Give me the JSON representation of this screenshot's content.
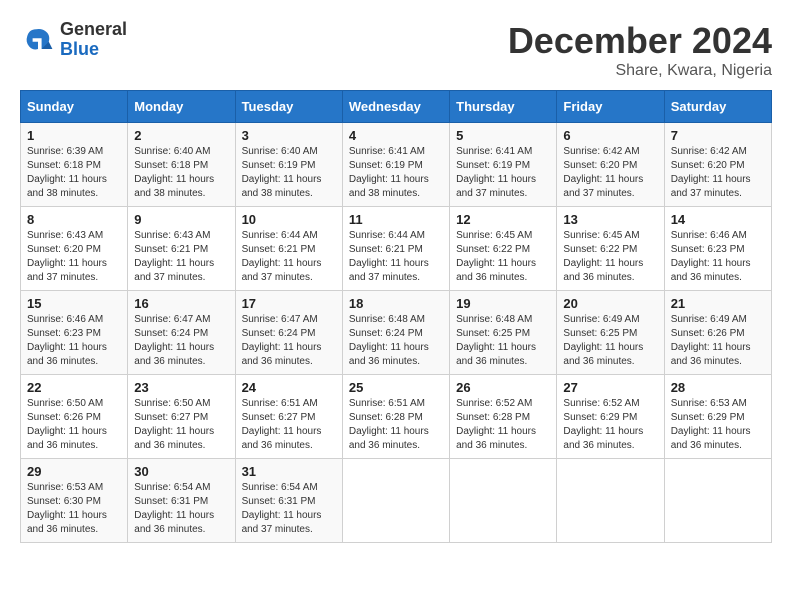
{
  "header": {
    "logo_general": "General",
    "logo_blue": "Blue",
    "title": "December 2024",
    "subtitle": "Share, Kwara, Nigeria"
  },
  "calendar": {
    "days_of_week": [
      "Sunday",
      "Monday",
      "Tuesday",
      "Wednesday",
      "Thursday",
      "Friday",
      "Saturday"
    ],
    "weeks": [
      [
        {
          "day": "1",
          "info": "Sunrise: 6:39 AM\nSunset: 6:18 PM\nDaylight: 11 hours\nand 38 minutes."
        },
        {
          "day": "2",
          "info": "Sunrise: 6:40 AM\nSunset: 6:18 PM\nDaylight: 11 hours\nand 38 minutes."
        },
        {
          "day": "3",
          "info": "Sunrise: 6:40 AM\nSunset: 6:19 PM\nDaylight: 11 hours\nand 38 minutes."
        },
        {
          "day": "4",
          "info": "Sunrise: 6:41 AM\nSunset: 6:19 PM\nDaylight: 11 hours\nand 38 minutes."
        },
        {
          "day": "5",
          "info": "Sunrise: 6:41 AM\nSunset: 6:19 PM\nDaylight: 11 hours\nand 37 minutes."
        },
        {
          "day": "6",
          "info": "Sunrise: 6:42 AM\nSunset: 6:20 PM\nDaylight: 11 hours\nand 37 minutes."
        },
        {
          "day": "7",
          "info": "Sunrise: 6:42 AM\nSunset: 6:20 PM\nDaylight: 11 hours\nand 37 minutes."
        }
      ],
      [
        {
          "day": "8",
          "info": "Sunrise: 6:43 AM\nSunset: 6:20 PM\nDaylight: 11 hours\nand 37 minutes."
        },
        {
          "day": "9",
          "info": "Sunrise: 6:43 AM\nSunset: 6:21 PM\nDaylight: 11 hours\nand 37 minutes."
        },
        {
          "day": "10",
          "info": "Sunrise: 6:44 AM\nSunset: 6:21 PM\nDaylight: 11 hours\nand 37 minutes."
        },
        {
          "day": "11",
          "info": "Sunrise: 6:44 AM\nSunset: 6:21 PM\nDaylight: 11 hours\nand 37 minutes."
        },
        {
          "day": "12",
          "info": "Sunrise: 6:45 AM\nSunset: 6:22 PM\nDaylight: 11 hours\nand 36 minutes."
        },
        {
          "day": "13",
          "info": "Sunrise: 6:45 AM\nSunset: 6:22 PM\nDaylight: 11 hours\nand 36 minutes."
        },
        {
          "day": "14",
          "info": "Sunrise: 6:46 AM\nSunset: 6:23 PM\nDaylight: 11 hours\nand 36 minutes."
        }
      ],
      [
        {
          "day": "15",
          "info": "Sunrise: 6:46 AM\nSunset: 6:23 PM\nDaylight: 11 hours\nand 36 minutes."
        },
        {
          "day": "16",
          "info": "Sunrise: 6:47 AM\nSunset: 6:24 PM\nDaylight: 11 hours\nand 36 minutes."
        },
        {
          "day": "17",
          "info": "Sunrise: 6:47 AM\nSunset: 6:24 PM\nDaylight: 11 hours\nand 36 minutes."
        },
        {
          "day": "18",
          "info": "Sunrise: 6:48 AM\nSunset: 6:24 PM\nDaylight: 11 hours\nand 36 minutes."
        },
        {
          "day": "19",
          "info": "Sunrise: 6:48 AM\nSunset: 6:25 PM\nDaylight: 11 hours\nand 36 minutes."
        },
        {
          "day": "20",
          "info": "Sunrise: 6:49 AM\nSunset: 6:25 PM\nDaylight: 11 hours\nand 36 minutes."
        },
        {
          "day": "21",
          "info": "Sunrise: 6:49 AM\nSunset: 6:26 PM\nDaylight: 11 hours\nand 36 minutes."
        }
      ],
      [
        {
          "day": "22",
          "info": "Sunrise: 6:50 AM\nSunset: 6:26 PM\nDaylight: 11 hours\nand 36 minutes."
        },
        {
          "day": "23",
          "info": "Sunrise: 6:50 AM\nSunset: 6:27 PM\nDaylight: 11 hours\nand 36 minutes."
        },
        {
          "day": "24",
          "info": "Sunrise: 6:51 AM\nSunset: 6:27 PM\nDaylight: 11 hours\nand 36 minutes."
        },
        {
          "day": "25",
          "info": "Sunrise: 6:51 AM\nSunset: 6:28 PM\nDaylight: 11 hours\nand 36 minutes."
        },
        {
          "day": "26",
          "info": "Sunrise: 6:52 AM\nSunset: 6:28 PM\nDaylight: 11 hours\nand 36 minutes."
        },
        {
          "day": "27",
          "info": "Sunrise: 6:52 AM\nSunset: 6:29 PM\nDaylight: 11 hours\nand 36 minutes."
        },
        {
          "day": "28",
          "info": "Sunrise: 6:53 AM\nSunset: 6:29 PM\nDaylight: 11 hours\nand 36 minutes."
        }
      ],
      [
        {
          "day": "29",
          "info": "Sunrise: 6:53 AM\nSunset: 6:30 PM\nDaylight: 11 hours\nand 36 minutes."
        },
        {
          "day": "30",
          "info": "Sunrise: 6:54 AM\nSunset: 6:31 PM\nDaylight: 11 hours\nand 36 minutes."
        },
        {
          "day": "31",
          "info": "Sunrise: 6:54 AM\nSunset: 6:31 PM\nDaylight: 11 hours\nand 37 minutes."
        },
        {
          "day": "",
          "info": ""
        },
        {
          "day": "",
          "info": ""
        },
        {
          "day": "",
          "info": ""
        },
        {
          "day": "",
          "info": ""
        }
      ]
    ]
  }
}
